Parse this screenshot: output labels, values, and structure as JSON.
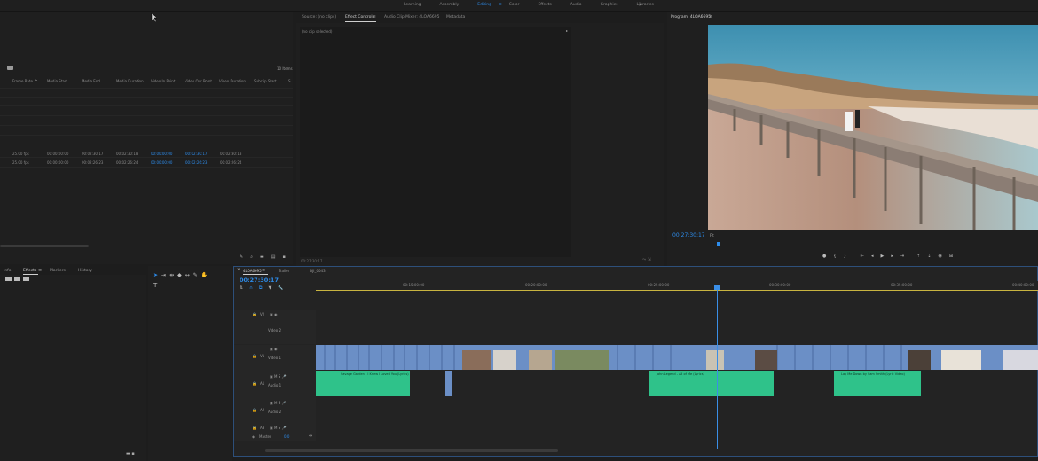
{
  "workspace": {
    "tabs": [
      "Learning",
      "Assembly",
      "Editing",
      "Color",
      "Effects",
      "Audio",
      "Graphics",
      "Libraries"
    ],
    "active_tab": "Editing",
    "more": "»"
  },
  "project": {
    "items_count": "10 Items",
    "columns": [
      "Frame Rate",
      "Media Start",
      "Media End",
      "Media Duration",
      "Video In Point",
      "Video Out Point",
      "Video Duration",
      "Subclip Start",
      "S"
    ],
    "rows": [
      [
        "25.00 fps",
        "00:00:00:00",
        "00:02:30:17",
        "00:02:30:18",
        "00:00:00:00",
        "00:02:30:17",
        "00:02:30:18"
      ],
      [
        "25.00 fps",
        "00:00:00:00",
        "00:02:26:23",
        "00:02:26:24",
        "00:00:00:00",
        "00:02:26:23",
        "00:02:26:24"
      ]
    ]
  },
  "effect_controls": {
    "tabs": [
      "Source: (no clips)",
      "Effect Controls",
      "Audio Clip Mixer: 4LOA6695",
      "Metadata"
    ],
    "active_tab": "Effect Controls",
    "no_clip": "(no clip selected)",
    "timecode": "00:27:30:17"
  },
  "program": {
    "title": "Program: 4LOA6695",
    "timecode": "00:27:30:17",
    "fit": "Fit"
  },
  "effects_panel": {
    "tabs": [
      "Info",
      "Effects",
      "Markers",
      "History"
    ],
    "active_tab": "Effects"
  },
  "timeline": {
    "tabs": [
      "4LOA6695",
      "Trailer",
      "DJI_0043"
    ],
    "timecode": "00:27:30:17",
    "ruler": [
      "00:15:00:00",
      "00:20:00:00",
      "00:25:00:00",
      "00:30:00:00",
      "00:35:00:00",
      "00:40:00:00"
    ],
    "tracks": {
      "v2": "V2",
      "v2_name": "Video 2",
      "v1": "V1",
      "v1_name": "Video 1",
      "a1": "A1",
      "a1_name": "Audio 1",
      "a2": "A2",
      "a2_name": "Audio 2",
      "a3": "A3",
      "master": "Master",
      "master_val": "0.0"
    },
    "audio_clips": [
      "Savage Garden - I Knew I Loved You (Lyrics)",
      "John Legend - All of Me (Lyrics)",
      "Lay Me Down by Sam Smith (Lyric Video)"
    ]
  },
  "colors": {
    "accent": "#2d8ceb",
    "video_clip": "#6b8fc6",
    "audio_clip": "#2fc28a",
    "playhead": "#3a8ee6"
  }
}
